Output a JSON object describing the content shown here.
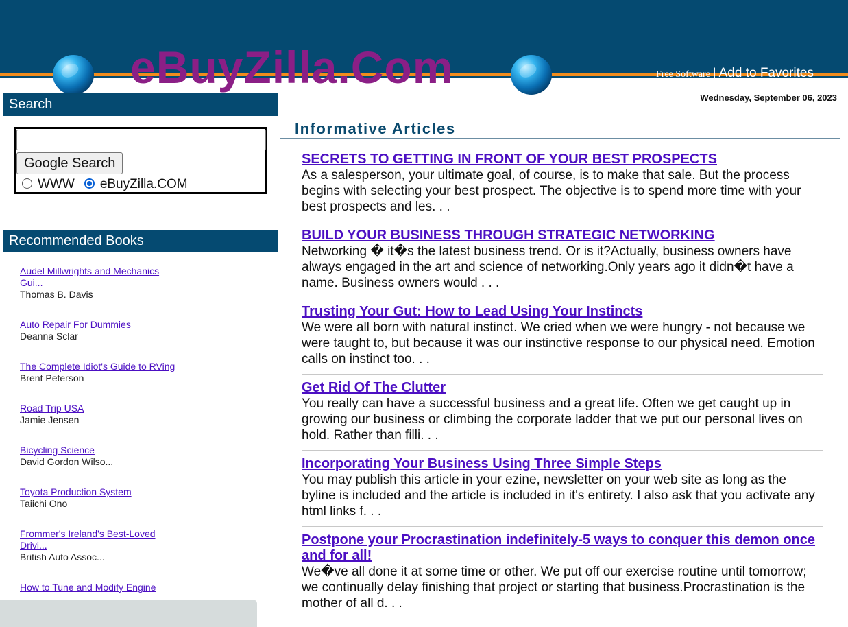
{
  "header": {
    "logo": "eBuyZilla.Com",
    "free_software": "Free Software",
    "separator": "|",
    "add_favorites": "Add to Favorites",
    "date": "Wednesday, September 06, 2023"
  },
  "search": {
    "title": "Search",
    "input_value": "",
    "button_label": "Google Search",
    "radio_www": "WWW",
    "radio_site": "eBuyZilla.COM",
    "selected": "eBuyZilla.COM"
  },
  "books": {
    "title": "Recommended Books",
    "items": [
      {
        "title": "Audel Millwrights and Mechanics Gui...",
        "author": "Thomas B. Davis"
      },
      {
        "title": "Auto Repair For Dummies",
        "author": "Deanna Sclar"
      },
      {
        "title": "The Complete Idiot's Guide to RVing",
        "author": "Brent Peterson"
      },
      {
        "title": "Road Trip USA",
        "author": "Jamie Jensen"
      },
      {
        "title": "Bicycling Science",
        "author": "David Gordon Wilso..."
      },
      {
        "title": "Toyota Production System",
        "author": "Taiichi Ono"
      },
      {
        "title": "Frommer's Ireland's Best-Loved Drivi...",
        "author": "British Auto Assoc..."
      },
      {
        "title": "How to Tune and Modify Engine",
        "author": ""
      }
    ]
  },
  "main": {
    "title": "Informative Articles",
    "articles": [
      {
        "title": "SECRETS TO GETTING IN FRONT OF YOUR BEST PROSPECTS",
        "summary": "As a salesperson, your ultimate goal, of course, is to make that sale. But the process begins with selecting your best prospect. The objective is to spend more time with your best prospects and les. . ."
      },
      {
        "title": "BUILD YOUR BUSINESS THROUGH STRATEGIC NETWORKING",
        "summary": "Networking � it�s the latest business trend. Or is it?Actually, business owners have always engaged in the art and science of networking.Only years ago it didn�t have a name. Business owners would . . ."
      },
      {
        "title": "Trusting Your Gut: How to Lead Using Your Instincts",
        "summary": "We were all born with natural instinct. We cried when we were hungry - not because we were taught to, but because it was our instinctive response to our physical need. Emotion calls on instinct too. . ."
      },
      {
        "title": "Get Rid Of The Clutter",
        "summary": "You really can have a successful business and a great life. Often we get caught up in growing our business or climbing the corporate ladder that we put our personal lives on hold. Rather than filli. . ."
      },
      {
        "title": "Incorporating Your Business Using Three Simple Steps",
        "summary": "You may publish this article in your ezine, newsletter on your web site as long as the byline is included and the article is included in it's entirety. I also ask that you activate any html links f. . ."
      },
      {
        "title": "Postpone your Procrastination indefinitely-5 ways to conquer this demon once and for all!",
        "summary": "We�ve all done it at some time or other. We put off our exercise routine until tomorrow; we continually delay finishing that project or starting that business.Procrastination is the mother of all d. . ."
      }
    ]
  },
  "colors": {
    "header_blue": "#054a71",
    "stripe_orange": "#f28c1c",
    "logo_purple": "#8b1f86",
    "link_purple": "#4c0fc3"
  }
}
